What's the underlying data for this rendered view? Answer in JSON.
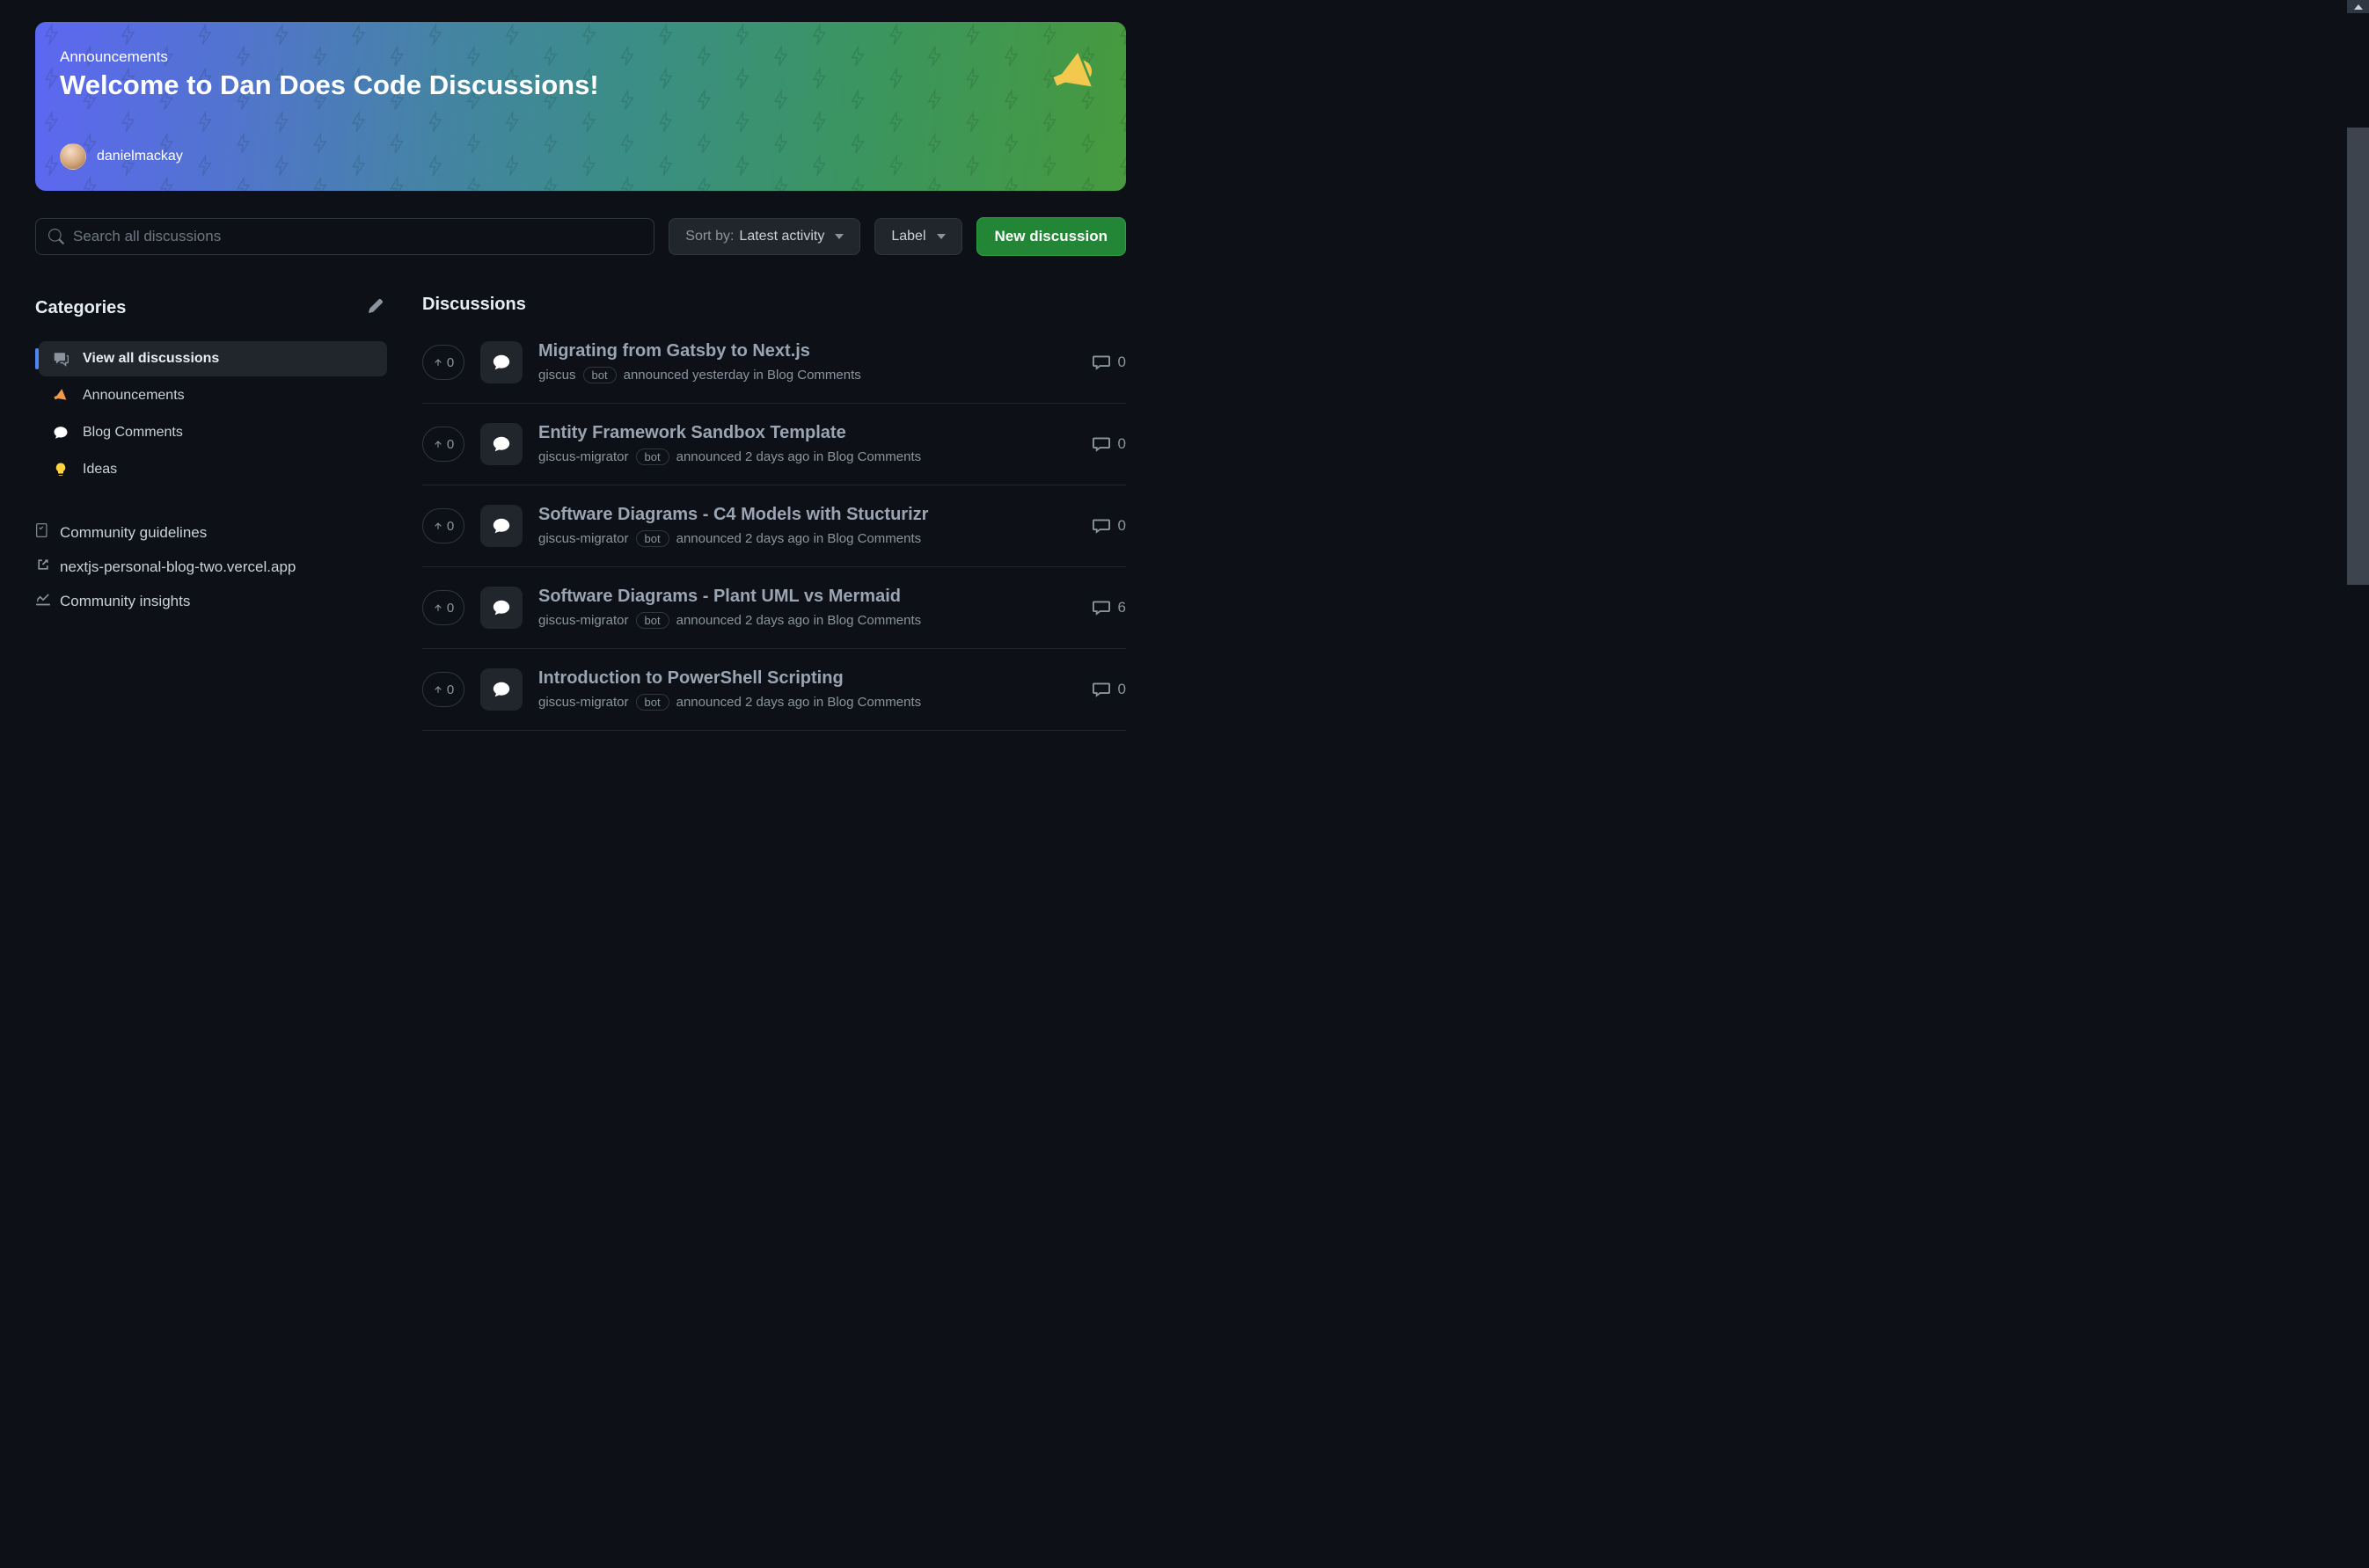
{
  "banner": {
    "category_label": "Announcements",
    "title": "Welcome to Dan Does Code Discussions!",
    "author": "danielmackay"
  },
  "toolbar": {
    "search_placeholder": "Search all discussions",
    "sort_prefix": "Sort by:",
    "sort_value": "Latest activity",
    "label_button": "Label",
    "new_button": "New discussion"
  },
  "sidebar": {
    "title": "Categories",
    "items": [
      {
        "label": "View all discussions",
        "active": true,
        "icon": "comment-discussion"
      },
      {
        "label": "Announcements",
        "active": false,
        "icon": "megaphone"
      },
      {
        "label": "Blog Comments",
        "active": false,
        "icon": "speech"
      },
      {
        "label": "Ideas",
        "active": false,
        "icon": "bulb"
      }
    ],
    "links": [
      {
        "label": "Community guidelines",
        "icon": "checklist"
      },
      {
        "label": "nextjs-personal-blog-two.vercel.app",
        "icon": "external"
      },
      {
        "label": "Community insights",
        "icon": "graph"
      }
    ]
  },
  "discussions": {
    "title": "Discussions",
    "items": [
      {
        "upvotes": "0",
        "title": "Migrating from Gatsby to Next.js",
        "author": "giscus",
        "bot": "bot",
        "meta_rest": "announced yesterday in Blog Comments",
        "comments": "0"
      },
      {
        "upvotes": "0",
        "title": "Entity Framework Sandbox Template",
        "author": "giscus-migrator",
        "bot": "bot",
        "meta_rest": "announced 2 days ago in Blog Comments",
        "comments": "0"
      },
      {
        "upvotes": "0",
        "title": "Software Diagrams - C4 Models with Stucturizr",
        "author": "giscus-migrator",
        "bot": "bot",
        "meta_rest": "announced 2 days ago in Blog Comments",
        "comments": "0"
      },
      {
        "upvotes": "0",
        "title": "Software Diagrams - Plant UML vs Mermaid",
        "author": "giscus-migrator",
        "bot": "bot",
        "meta_rest": "announced 2 days ago in Blog Comments",
        "comments": "6"
      },
      {
        "upvotes": "0",
        "title": "Introduction to PowerShell Scripting",
        "author": "giscus-migrator",
        "bot": "bot",
        "meta_rest": "announced 2 days ago in Blog Comments",
        "comments": "0"
      }
    ]
  }
}
